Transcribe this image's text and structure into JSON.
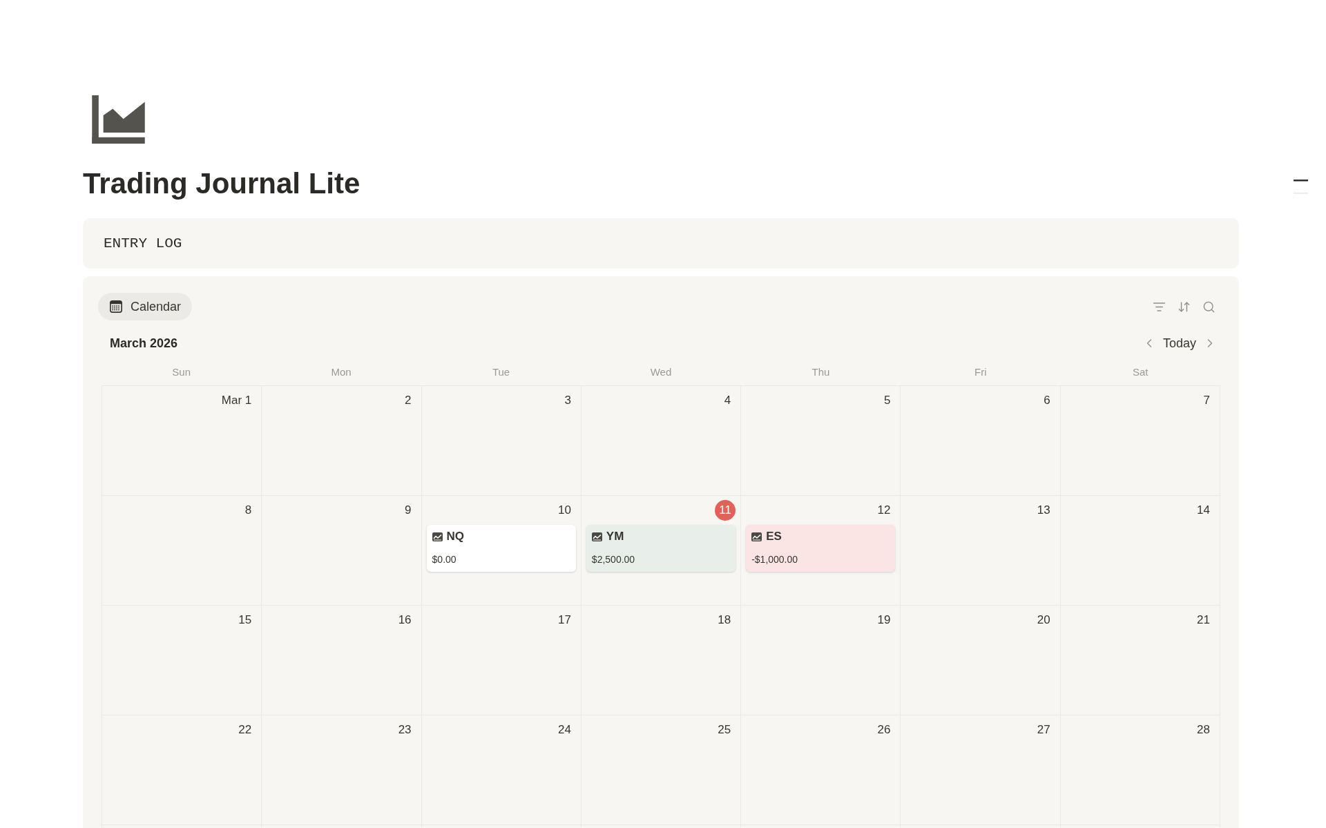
{
  "page": {
    "title": "Trading Journal Lite"
  },
  "callout": {
    "text": "ENTRY LOG"
  },
  "database": {
    "views": [
      {
        "label": "Calendar",
        "selected": true
      }
    ],
    "calendar": {
      "month": "March 2026",
      "today_button": "Today",
      "weekdays": [
        "Sun",
        "Mon",
        "Tue",
        "Wed",
        "Thu",
        "Fri",
        "Sat"
      ],
      "weeks": [
        {
          "days": [
            {
              "label": "Mar 1",
              "today": false
            },
            {
              "label": "2",
              "today": false
            },
            {
              "label": "3",
              "today": false
            },
            {
              "label": "4",
              "today": false
            },
            {
              "label": "5",
              "today": false
            },
            {
              "label": "6",
              "today": false
            },
            {
              "label": "7",
              "today": false
            }
          ]
        },
        {
          "days": [
            {
              "label": "8",
              "today": false
            },
            {
              "label": "9",
              "today": false
            },
            {
              "label": "10",
              "today": false,
              "events": [
                {
                  "symbol": "NQ",
                  "amount": "$0.00",
                  "color": "#ffffff"
                }
              ]
            },
            {
              "label": "11",
              "today": true,
              "events": [
                {
                  "symbol": "YM",
                  "amount": "$2,500.00",
                  "color": "#e8efea"
                }
              ]
            },
            {
              "label": "12",
              "today": false,
              "events": [
                {
                  "symbol": "ES",
                  "amount": "-$1,000.00",
                  "color": "#fbe5e4"
                }
              ]
            },
            {
              "label": "13",
              "today": false
            },
            {
              "label": "14",
              "today": false
            }
          ]
        },
        {
          "days": [
            {
              "label": "15",
              "today": false
            },
            {
              "label": "16",
              "today": false
            },
            {
              "label": "17",
              "today": false
            },
            {
              "label": "18",
              "today": false
            },
            {
              "label": "19",
              "today": false
            },
            {
              "label": "20",
              "today": false
            },
            {
              "label": "21",
              "today": false
            }
          ]
        },
        {
          "days": [
            {
              "label": "22",
              "today": false
            },
            {
              "label": "23",
              "today": false
            },
            {
              "label": "24",
              "today": false
            },
            {
              "label": "25",
              "today": false
            },
            {
              "label": "26",
              "today": false
            },
            {
              "label": "27",
              "today": false
            },
            {
              "label": "28",
              "today": false
            }
          ]
        }
      ]
    }
  }
}
